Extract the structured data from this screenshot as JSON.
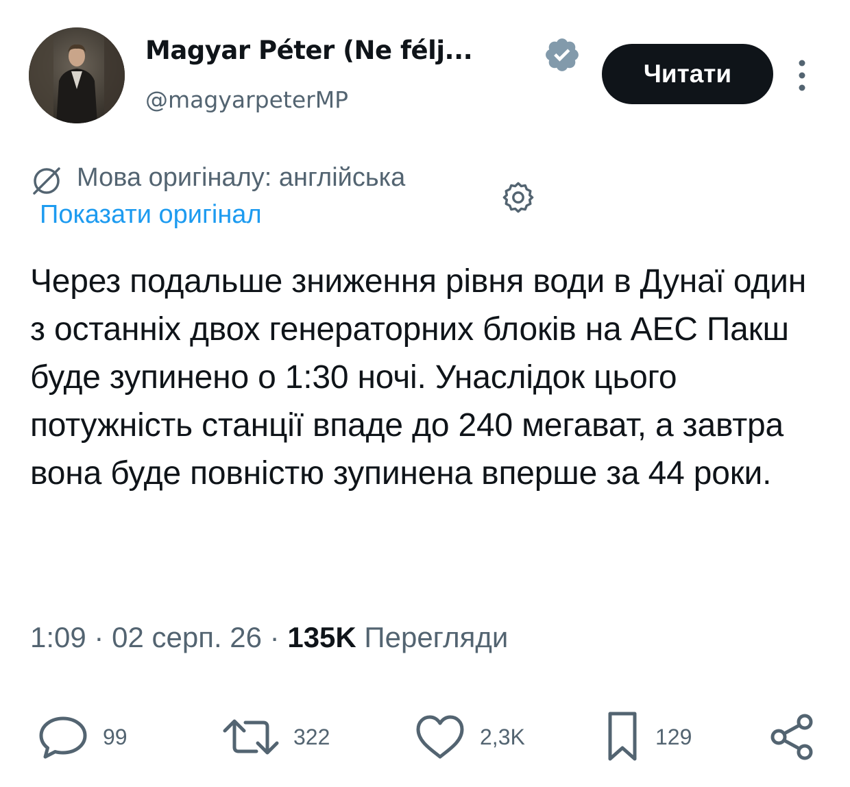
{
  "author": {
    "display_name": "Magyar Péter (Ne félj...",
    "handle": "@magyarpeterMP",
    "verified": true
  },
  "follow_button": {
    "label": "Читати"
  },
  "translation": {
    "note": "Мова оригіналу: англійська",
    "show_original": "Показати оригінал"
  },
  "tweet": {
    "text": "Через подальше зниження рівня води в Дунаї один з останніх двох генераторних блоків на АЕС Пакш буде зупинено о 1:30 ночі. Унаслідок цього потужність станції впаде до 240 мегават, а завтра вона буде повністю зупинена вперше за 44 роки."
  },
  "meta": {
    "time": "1:09",
    "separator": "·",
    "date": "02 серп. 26",
    "views_count": "135K",
    "views_label": "Перегляди"
  },
  "actions": {
    "replies": "99",
    "retweets": "322",
    "likes": "2,3K",
    "bookmarks": "129"
  },
  "icons": {
    "verified": "verified-badge-icon",
    "more": "more-vertical-icon",
    "translate": "globe-icon",
    "settings": "gear-icon",
    "reply": "reply-icon",
    "retweet": "retweet-icon",
    "like": "heart-icon",
    "bookmark": "bookmark-icon",
    "share": "share-icon"
  },
  "colors": {
    "text": "#0f1419",
    "secondary": "#536471",
    "link": "#1d9bf0",
    "button_bg": "#0f1419",
    "verified_gray": "#829aab"
  }
}
